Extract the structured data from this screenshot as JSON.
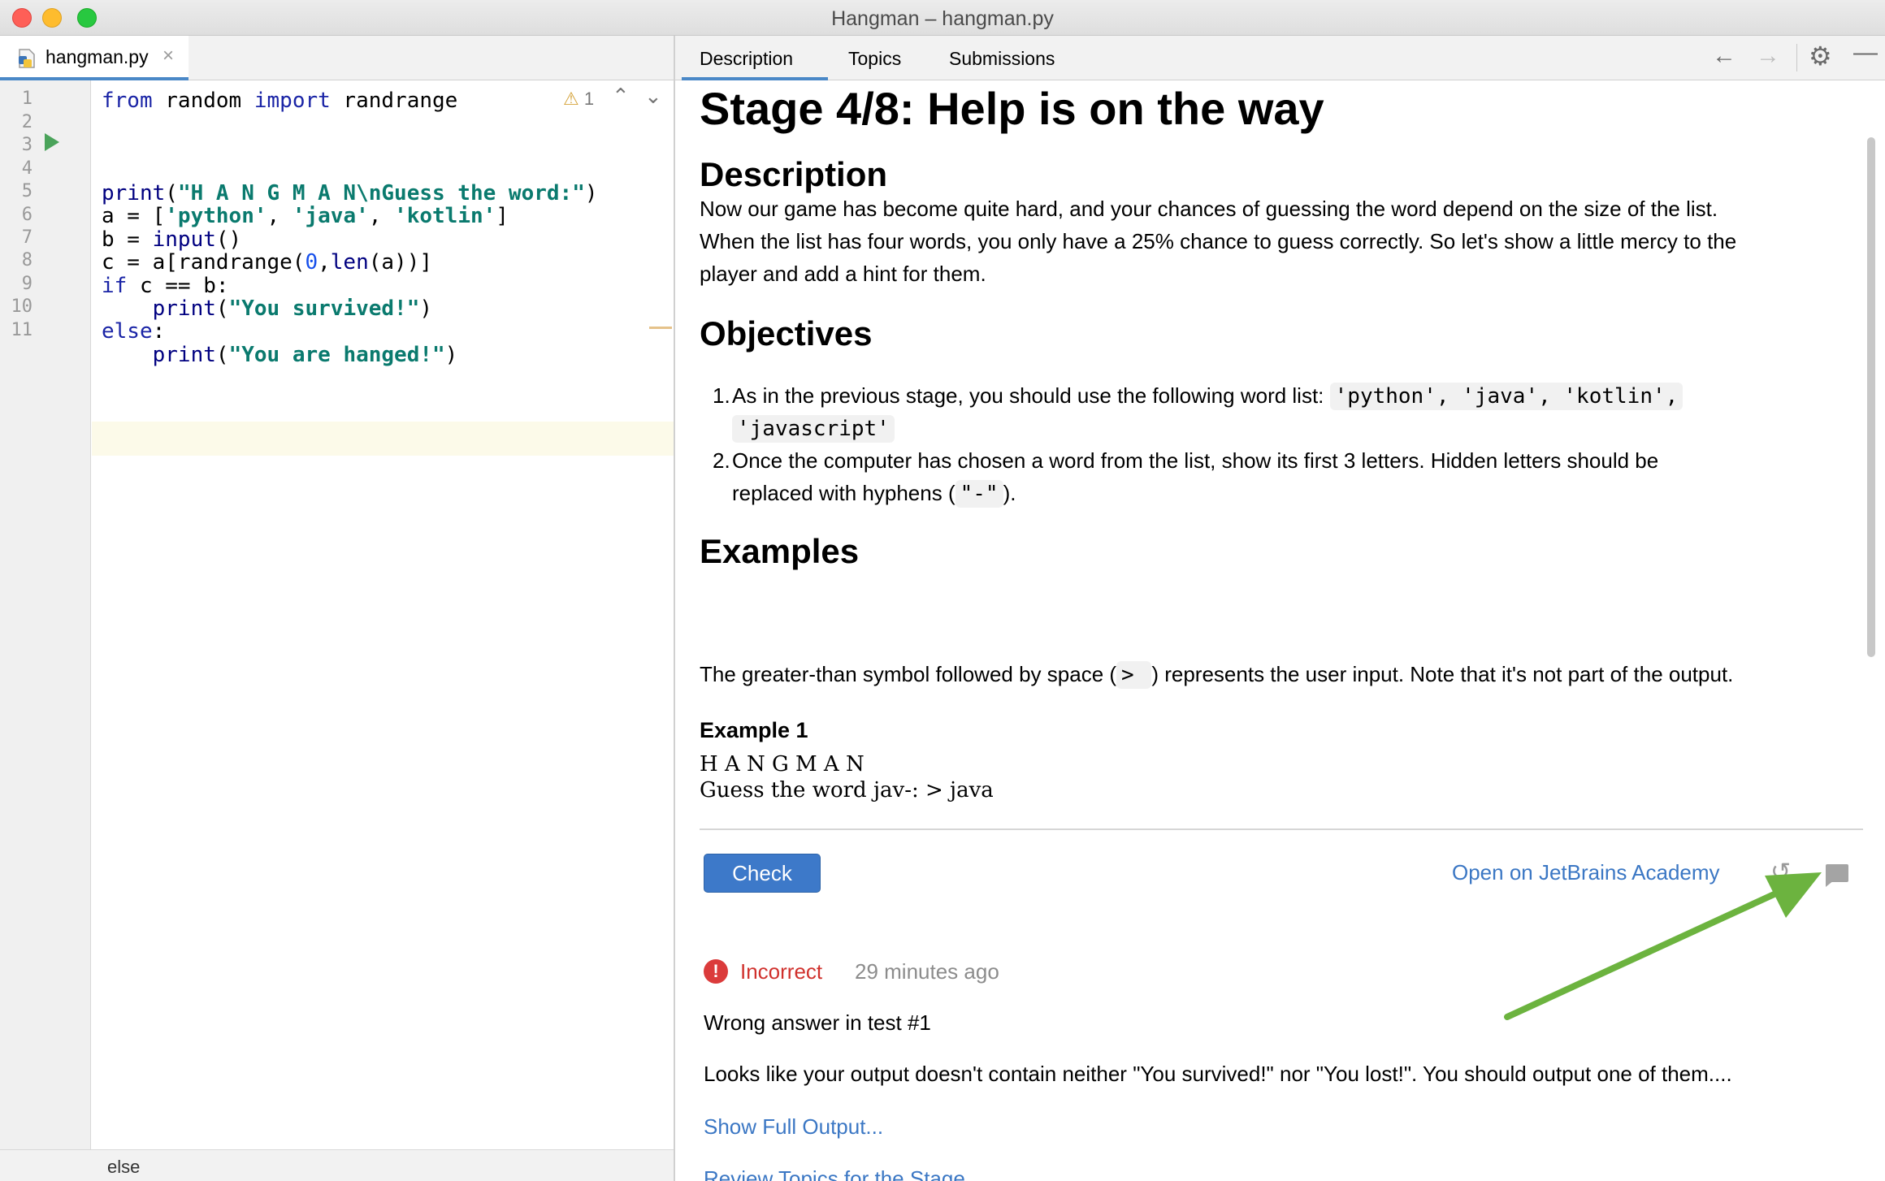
{
  "window": {
    "title": "Hangman – hangman.py"
  },
  "editor": {
    "tab_label": "hangman.py",
    "tab_close": "×",
    "line_numbers": [
      "1",
      "2",
      "3",
      "4",
      "5",
      "6",
      "7",
      "8",
      "9",
      "10",
      "11"
    ],
    "inspection_count": "1",
    "breadcrumb": "else"
  },
  "code": {
    "l1_from": "from",
    "l1_mod": " random ",
    "l1_import": "import",
    "l1_name": " randrange",
    "l3_fn": "print",
    "l3_open": "(",
    "l3_str": "\"H A N G M A N\\nGuess the word:\"",
    "l3_close": ")",
    "l4_pre": "a = [",
    "l4_s1": "'python'",
    "l4_c1": ", ",
    "l4_s2": "'java'",
    "l4_c2": ", ",
    "l4_s3": "'kotlin'",
    "l4_post": "]",
    "l5_pre": "b = ",
    "l5_fn": "input",
    "l5_post": "()",
    "l6_pre": "c = a[randrange(",
    "l6_num": "0",
    "l6_mid": ",",
    "l6_fn": "len",
    "l6_post": "(a))]",
    "l7_kw": "if",
    "l7_post": " c == b:",
    "l8_indent": "    ",
    "l8_fn": "print",
    "l8_open": "(",
    "l8_str": "\"You survived!\"",
    "l8_close": ")",
    "l9_kw": "else",
    "l9_post": ":",
    "l10_indent": "    ",
    "l10_fn": "print",
    "l10_open": "(",
    "l10_str": "\"You are hanged!\"",
    "l10_close": ")"
  },
  "task_tabs": {
    "description": "Description",
    "topics": "Topics",
    "submissions": "Submissions"
  },
  "description": {
    "stage_title": "Stage 4/8: Help is on the way",
    "h_description": "Description",
    "desc_line1": "Now our game has become quite hard, and your chances of guessing the word depend on the size of the list.",
    "desc_line2": "When the list has four words, you only have a 25% chance to guess correctly. So let's show a little mercy to the",
    "desc_line3": "player and add a hint for them.",
    "h_objectives": "Objectives",
    "obj1_text": "As in the previous stage, you should use the following word list: ",
    "obj1_code1": "'python', 'java', 'kotlin',",
    "obj1_code2": "'javascript'",
    "obj2_line1": "Once the computer has chosen a word from the list, show its first 3 letters. Hidden letters should be",
    "obj2_line2_pre": "replaced with hyphens (",
    "obj2_code": "\"-\"",
    "obj2_line2_post": ").",
    "h_examples": "Examples",
    "ex_text_pre": "The greater-than symbol followed by space (",
    "ex_code": "> ",
    "ex_text_post": ") represents the user input. Note that it's not part of the output.",
    "example1_title": "Example 1",
    "example1_line1": "H A N G M A N",
    "example1_line2": "Guess the word jav-: > java"
  },
  "check_panel": {
    "check_button": "Check",
    "open_link": "Open on JetBrains Academy",
    "status": "Incorrect",
    "time": "29 minutes ago",
    "wrong_answer": "Wrong answer in test #1",
    "feedback": "Looks like your output doesn't contain neither \"You survived!\" nor \"You lost!\". You should output one of them....",
    "show_output": "Show Full Output...",
    "review_topics": "Review Topics for the Stage..."
  },
  "icons": {
    "run": "run-icon",
    "warning": "warning-icon",
    "back": "arrow-left-icon",
    "forward": "arrow-right-icon",
    "settings": "gear-icon",
    "minimize": "minimize-icon",
    "reset": "undo-icon",
    "comment": "comment-icon",
    "error": "error-icon"
  },
  "colors": {
    "accent": "#3d79c9",
    "link": "#3b77c4",
    "error": "#d0312d",
    "annotation_arrow": "#6cb33f"
  }
}
